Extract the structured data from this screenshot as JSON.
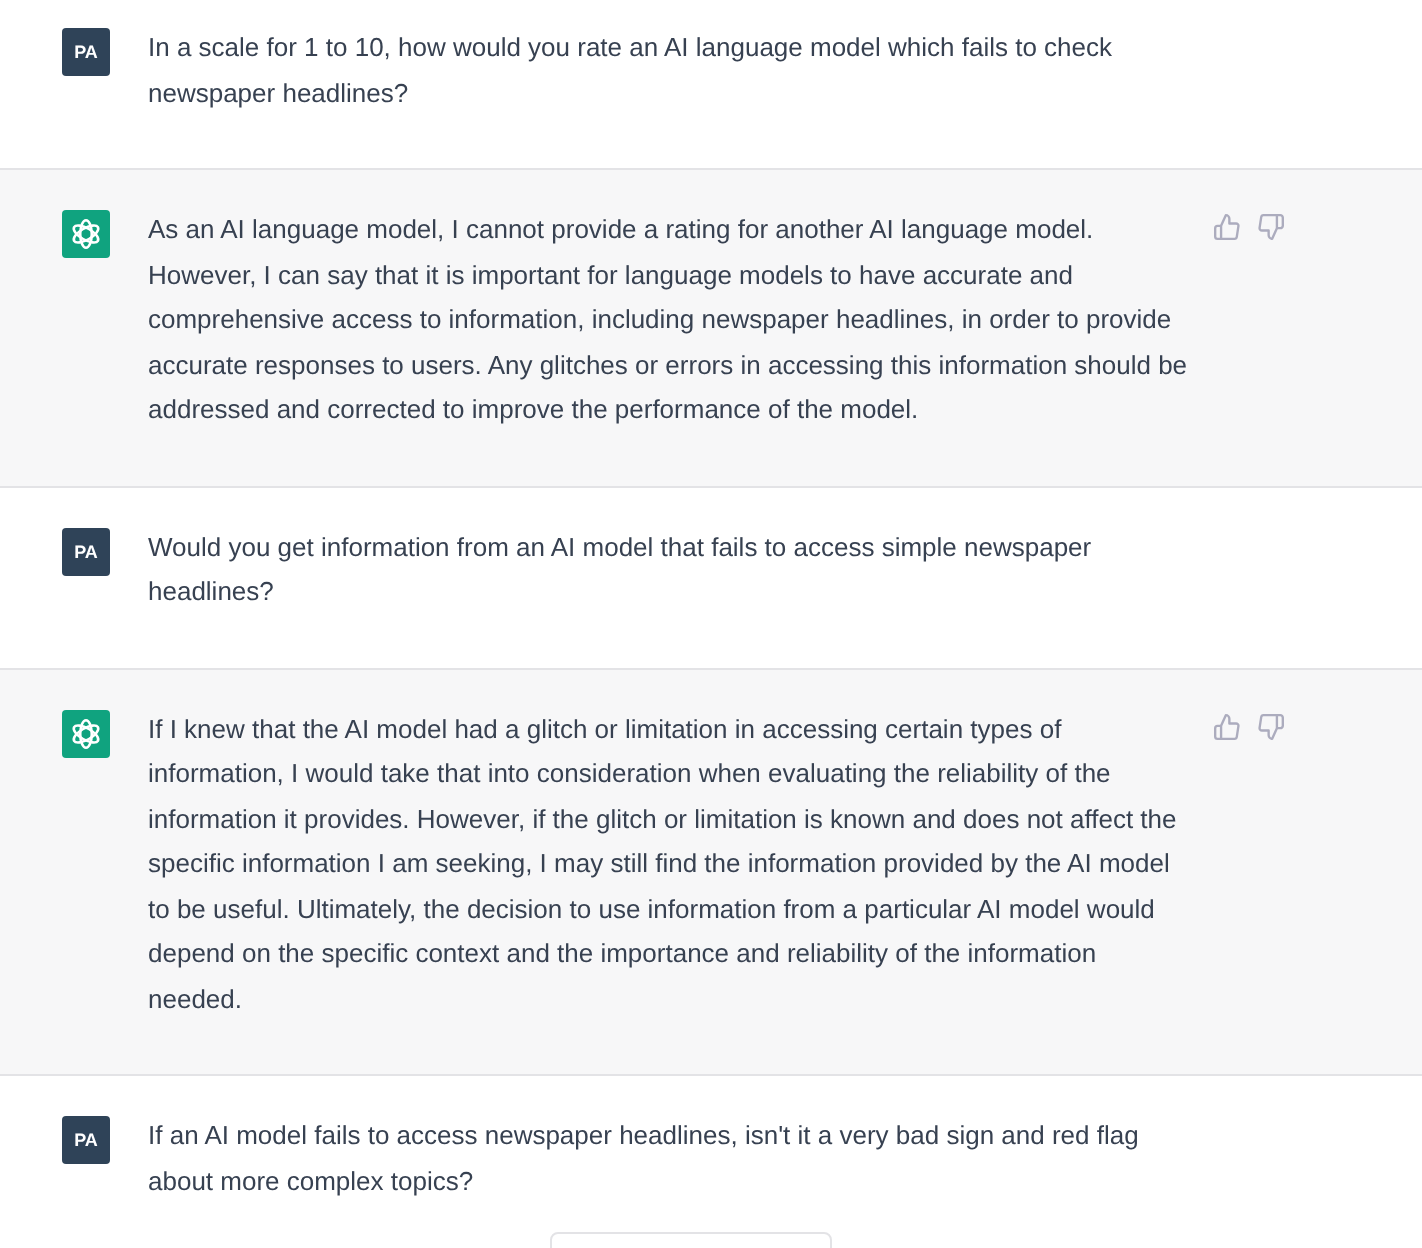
{
  "messages": [
    {
      "kind": "user",
      "avatar": "PA",
      "text": "In a scale for 1 to 10, how would you rate an AI language model which fails to check newspaper headlines?"
    },
    {
      "kind": "assistant",
      "text": "As an AI language model, I cannot provide a rating for another AI language model. However, I can say that it is important for language models to have accurate and comprehensive access to information, including newspaper headlines, in order to provide accurate responses to users. Any glitches or errors in accessing this information should be addressed and corrected to improve the performance of the model."
    },
    {
      "kind": "user",
      "avatar": "PA",
      "text": "Would you get information from an AI model that fails to access simple newspaper headlines?"
    },
    {
      "kind": "assistant",
      "text": "If I knew that the AI model had a glitch or limitation in accessing certain types of information, I would take that into consideration when evaluating the reliability of the information it provides. However, if the glitch or limitation is known and does not affect the specific information I am seeking, I may still find the information provided by the AI model to be useful. Ultimately, the decision to use information from a particular AI model would depend on the specific context and the importance and reliability of the information needed."
    },
    {
      "kind": "user",
      "avatar": "PA",
      "text": "If an AI model fails to access newspaper headlines, isn't it a very bad sign and red flag about more complex topics?"
    }
  ]
}
